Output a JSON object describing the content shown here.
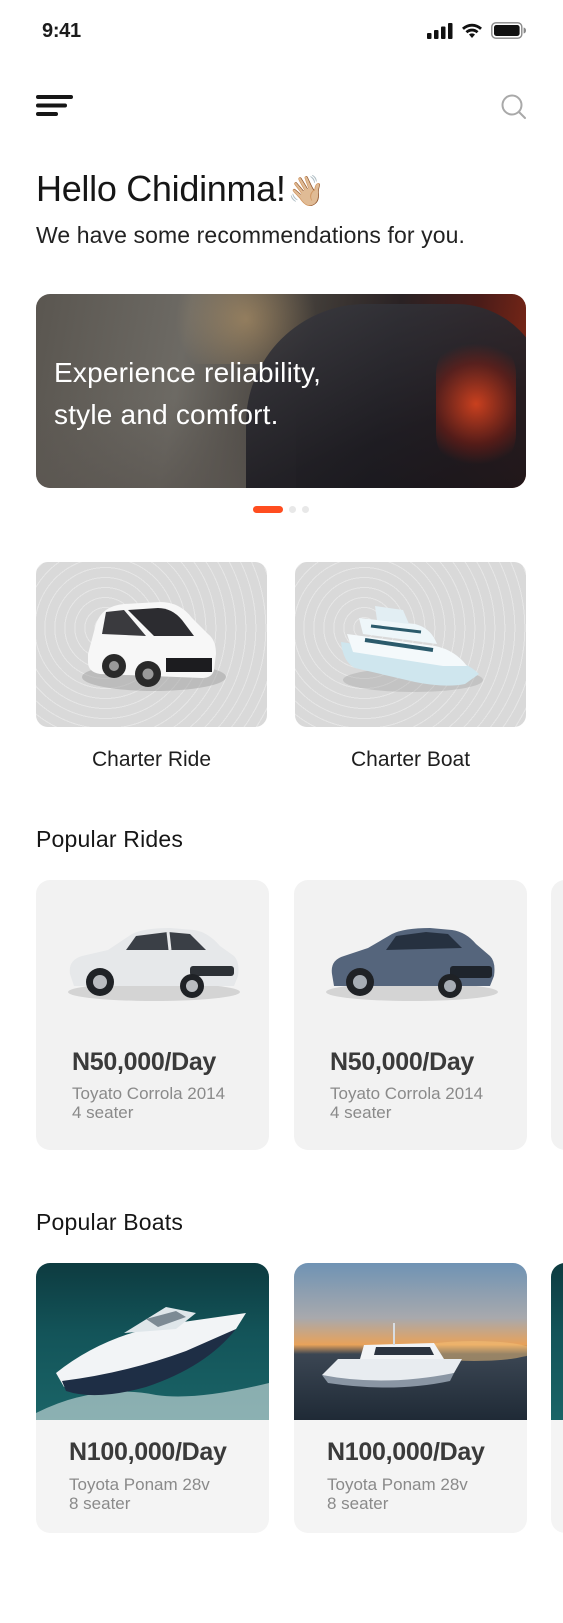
{
  "status_bar": {
    "time": "9:41"
  },
  "greeting": {
    "title": "Hello Chidinma!",
    "wave_emoji": "👋🏼",
    "subtitle": "We have some recommendations for you."
  },
  "banner": {
    "line1": "Experience reliability,",
    "line2": "style and comfort."
  },
  "carousel": {
    "active_index": 0,
    "count": 3,
    "active_color": "#ff4d1f"
  },
  "categories": [
    {
      "label": "Charter Ride",
      "icon": "white-car-icon"
    },
    {
      "label": "Charter Boat",
      "icon": "yacht-icon"
    }
  ],
  "popular_rides": {
    "title": "Popular Rides",
    "items": [
      {
        "price": "N50,000/Day",
        "model": "Toyato Corrola 2014",
        "seats": "4 seater",
        "color": "#e6e8ea"
      },
      {
        "price": "N50,000/Day",
        "model": "Toyato Corrola 2014",
        "seats": "4 seater",
        "color": "#55657c"
      }
    ]
  },
  "popular_boats": {
    "title": "Popular Boats",
    "items": [
      {
        "price": "N100,000/Day",
        "model": "Toyota Ponam 28v",
        "seats": "8 seater"
      },
      {
        "price": "N100,000/Day",
        "model": "Toyota Ponam 28v",
        "seats": "8 seater"
      }
    ]
  },
  "icons": {
    "menu": "hamburger-menu-icon",
    "search": "search-icon"
  }
}
